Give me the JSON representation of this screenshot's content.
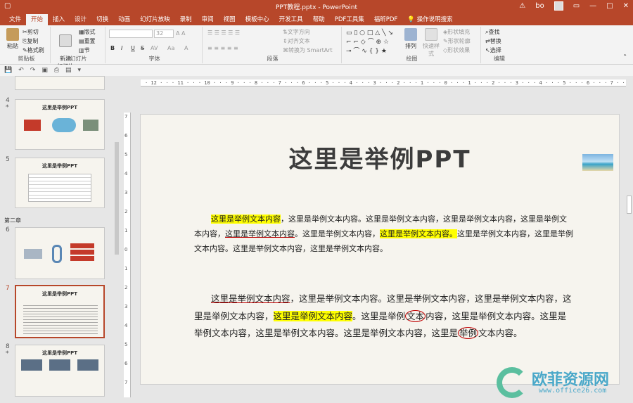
{
  "window": {
    "title": "PPT教程.pptx  -  PowerPoint",
    "user": "bo",
    "warning_icon": "warning-icon"
  },
  "tabs": [
    "文件",
    "开始",
    "插入",
    "设计",
    "切换",
    "动画",
    "幻灯片放映",
    "录制",
    "审阅",
    "视图",
    "模板中心",
    "开发工具",
    "帮助",
    "PDF工具集",
    "福昕PDF",
    "操作说明搜索"
  ],
  "ribbon": {
    "clipboard": {
      "label": "剪贴板",
      "paste": "粘贴",
      "cut": "剪切",
      "copy": "复制",
      "format_painter": "格式刷"
    },
    "slides": {
      "label": "幻灯片",
      "new_slide": "新建\n幻灯片",
      "layout": "版式",
      "reset": "重置",
      "section": "节"
    },
    "font": {
      "label": "字体",
      "font_size": "32",
      "bold": "B",
      "italic": "I",
      "underline": "U",
      "strike": "S",
      "char_spacing": "AV",
      "change_case": "Aa"
    },
    "paragraph": {
      "label": "段落",
      "text_direction": "文字方向",
      "align_text": "对齐文本",
      "smartart": "转换为 SmartArt"
    },
    "drawing": {
      "label": "绘图",
      "arrange": "排列",
      "quick_styles": "快速样式",
      "shape_fill": "形状填充",
      "shape_outline": "形状轮廓",
      "shape_effects": "形状效果"
    },
    "editing": {
      "label": "编辑",
      "find": "查找",
      "replace": "替换",
      "select": "选择"
    }
  },
  "thumbnails": {
    "slide_numbers": [
      "4",
      "5",
      "6",
      "7",
      "8"
    ],
    "section_name": "第二章",
    "slide_title": "这里是举例PPT"
  },
  "ruler": {
    "horizontal": "· 12 · · · 11 · · · 10 · · · 9 · · · 8 · · · 7 · · · 6 · · · 5 · · · 4 · · · 3 · · · 2 · · · 1 · · · 0 · · · 1 · · · 2 · · · 3 · · · 4 · · · 5 · · · 6 · · · 7 · · · 8 · · · 9 · · · 10 · · · 11 · · · 12 ·",
    "vertical": [
      "7",
      "6",
      "5",
      "4",
      "3",
      "2",
      "1",
      "0",
      "1",
      "2",
      "3",
      "4",
      "5",
      "6",
      "7"
    ]
  },
  "slide": {
    "title": "这里是举例PPT",
    "para1": {
      "a": "这里是举例文本内容",
      "b": "，这里是举例文本内容。这里是举例文本内容，这里是举例文本内容，这里是举例文本内容，",
      "c": "这里是举例文本内容",
      "d": "。这里是举例文本内容，",
      "e": "这里是举例文本内容。",
      "f": "这里是举例文本内容，这里是举例文本内容。这里是举例文本内容，这里是举例文本内容。"
    },
    "para2": {
      "a": "这里是举例文本内容",
      "b": "，这里是举例文本内容。这里是举例文本内容，这里是举例文本内容，这里是举例文本内容，",
      "c": "这里是举例文本内容",
      "d": "。这里是举例",
      "e": "文本",
      "f": "内容，这里是举例文本内容。这里是举例文本内容，这里是举例文本内容。这里是举例文本内容，这里是",
      "g": "举例",
      "h": "文本内容。"
    }
  },
  "watermark": {
    "brand": "欧菲资源网",
    "url": "www.office26.com"
  },
  "colors": {
    "accent": "#b7472a",
    "highlight": "#ffff00",
    "ink": "#c00000"
  }
}
